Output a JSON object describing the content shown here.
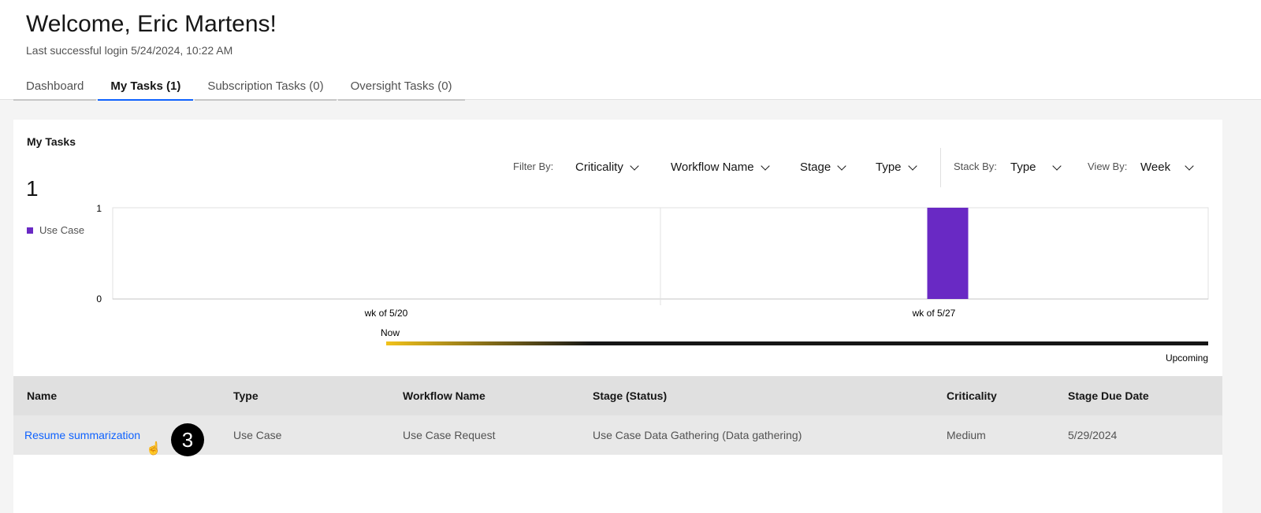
{
  "header": {
    "title": "Welcome, Eric Martens!",
    "last_login": "Last successful login 5/24/2024, 10:22 AM"
  },
  "tabs": [
    {
      "label": "Dashboard"
    },
    {
      "label": "My Tasks (1)",
      "active": true
    },
    {
      "label": "Subscription Tasks (0)"
    },
    {
      "label": "Oversight Tasks (0)"
    }
  ],
  "card": {
    "title": "My Tasks",
    "count": "1",
    "legend": "Use Case",
    "filters": {
      "filter_by": "Filter By:",
      "criticality": "Criticality",
      "workflow": "Workflow Name",
      "stage": "Stage",
      "type": "Type",
      "stack_by": "Stack By:",
      "stack_value": "Type",
      "view_by": "View By:",
      "view_value": "Week"
    }
  },
  "chart_data": {
    "type": "bar",
    "categories": [
      "wk of 5/20",
      "wk of 5/27"
    ],
    "series": [
      {
        "name": "Use Case",
        "values": [
          0,
          1
        ],
        "color": "#6929c4"
      }
    ],
    "yticks": [
      "0",
      "1"
    ],
    "ylim": [
      0,
      1
    ],
    "timeline": {
      "start": "Now",
      "end": "Upcoming"
    }
  },
  "table": {
    "headers": [
      "Name",
      "Type",
      "Workflow Name",
      "Stage (Status)",
      "Criticality",
      "Stage Due Date"
    ],
    "rows": [
      [
        "Resume summarization",
        "Use Case",
        "Use Case Request",
        "Use Case Data Gathering (Data gathering)",
        "Medium",
        "5/29/2024"
      ]
    ]
  },
  "annotation": "3"
}
